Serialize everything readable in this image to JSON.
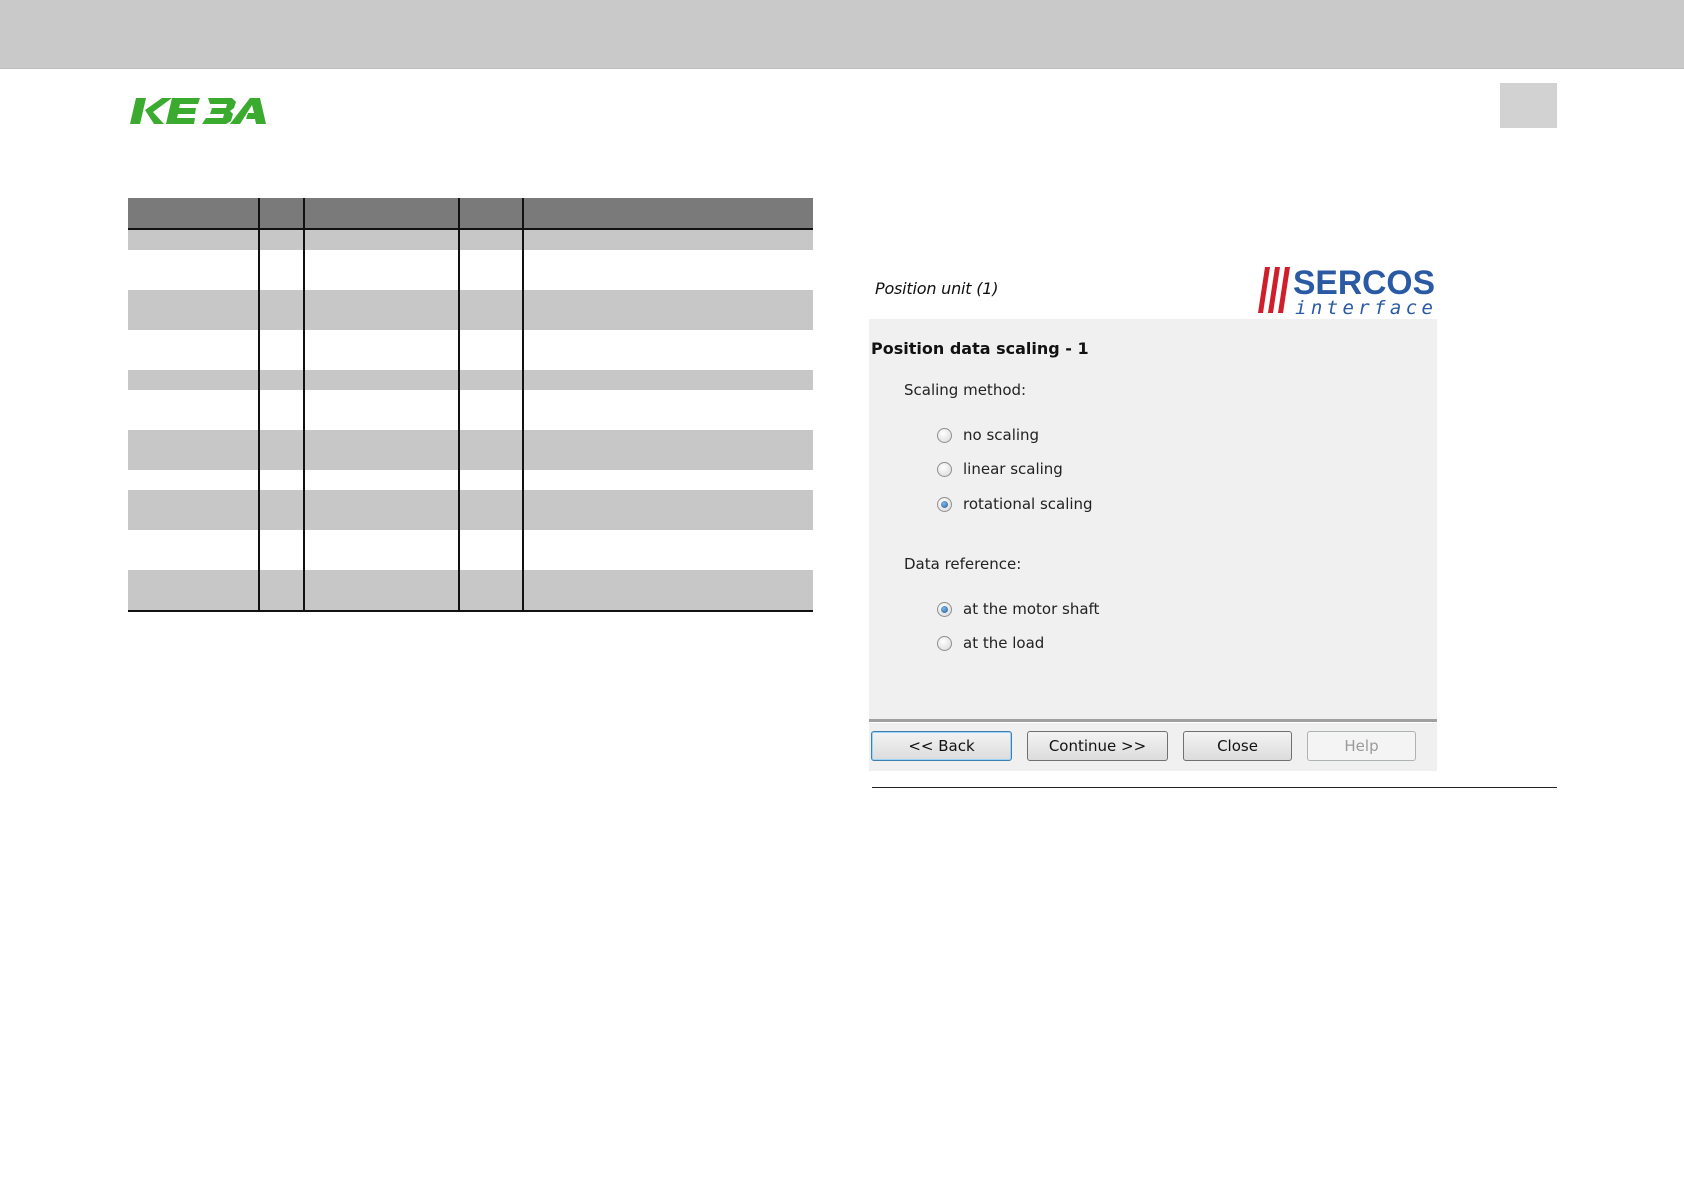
{
  "header": {
    "brand": "KEBA",
    "brand_color": "#3aab2e"
  },
  "table": {
    "rows": [
      "shade",
      "white",
      "shade",
      "white",
      "shade",
      "white",
      "shade",
      "white",
      "shade",
      "white",
      "shade"
    ],
    "row_heights": [
      20,
      40,
      40,
      40,
      20,
      40,
      40,
      20,
      40,
      40,
      40
    ]
  },
  "dialog": {
    "header_title": "Position unit (1)",
    "logo_text_top": "SERCOS",
    "logo_text_bottom": "interface",
    "logo_color_bars": "#d01e2a",
    "logo_color_text": "#2b5aa5",
    "section_title": "Position data scaling - 1",
    "scaling_label": "Scaling method:",
    "scaling_options": [
      {
        "label": "no scaling",
        "checked": false
      },
      {
        "label": "linear scaling",
        "checked": false
      },
      {
        "label": "rotational scaling",
        "checked": true
      }
    ],
    "reference_label": "Data reference:",
    "reference_options": [
      {
        "label": "at the motor shaft",
        "checked": true
      },
      {
        "label": "at the load",
        "checked": false
      }
    ],
    "buttons": {
      "back": "<< Back",
      "continue": "Continue >>",
      "close": "Close",
      "help": "Help"
    }
  }
}
